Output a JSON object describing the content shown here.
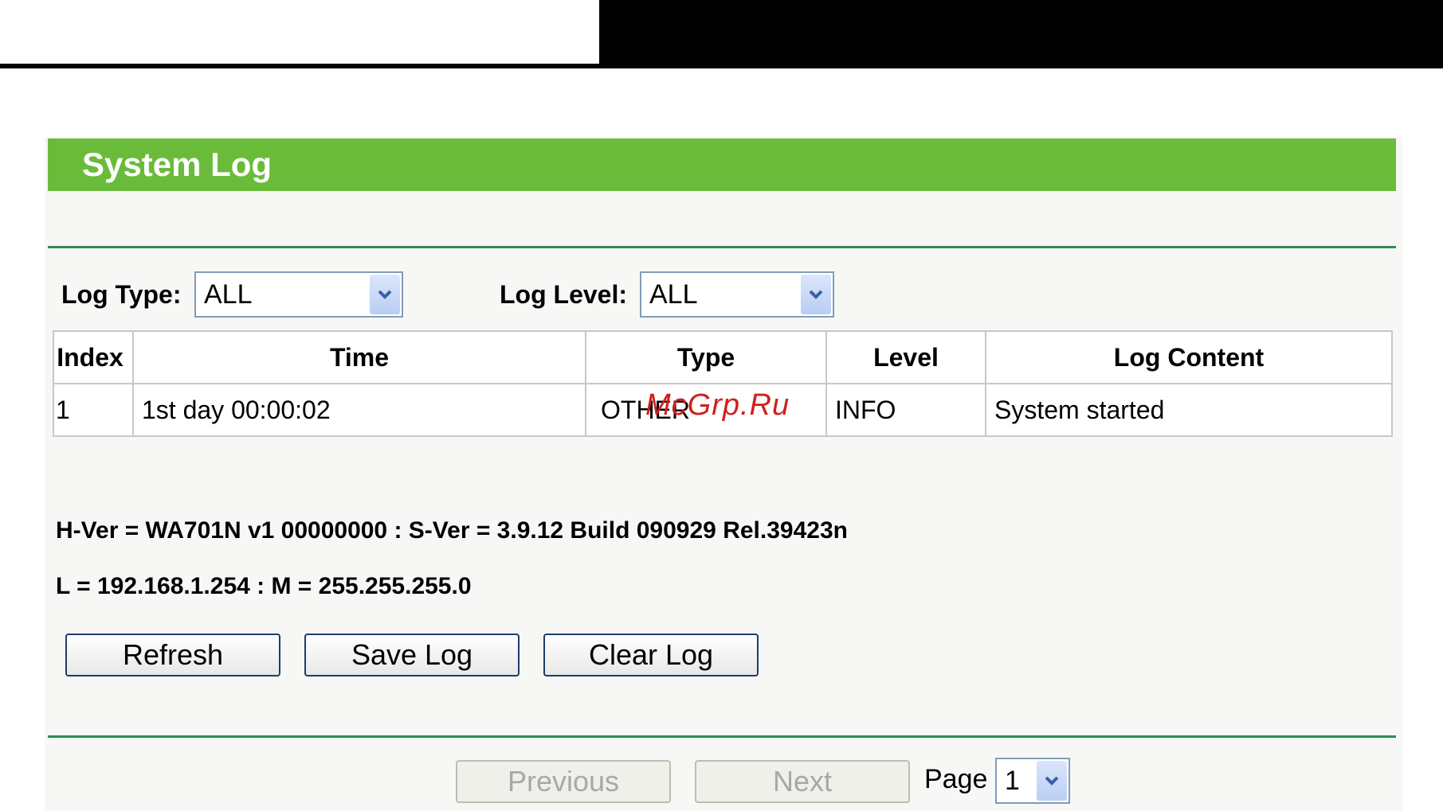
{
  "title": "System Log",
  "filters": {
    "log_type_label": "Log Type:",
    "log_type_value": "ALL",
    "log_level_label": "Log Level:",
    "log_level_value": "ALL"
  },
  "table": {
    "headers": [
      "Index",
      "Time",
      "Type",
      "Level",
      "Log Content"
    ],
    "rows": [
      [
        "1",
        "1st day 00:00:02",
        "OTHER",
        "INFO",
        "System started"
      ]
    ]
  },
  "info": {
    "version_line": "H-Ver = WA701N v1 00000000 : S-Ver = 3.9.12 Build 090929 Rel.39423n",
    "network_line": "L = 192.168.1.254 : M = 255.255.255.0"
  },
  "actions": {
    "refresh": "Refresh",
    "save_log": "Save Log",
    "clear_log": "Clear Log"
  },
  "pagination": {
    "previous": "Previous",
    "next": "Next",
    "page_label": "Page",
    "page_value": "1"
  },
  "watermark": "McGrp.Ru",
  "colors": {
    "title_bar": "#6abb3a",
    "rule": "#2f8a55",
    "button_border": "#1c3d6a",
    "watermark": "#d21e1e"
  }
}
